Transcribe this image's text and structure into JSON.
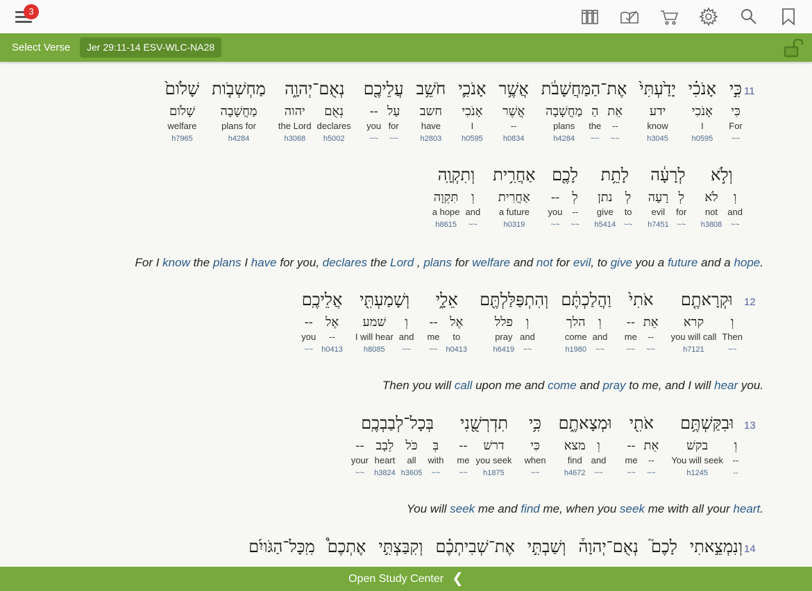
{
  "topbar": {
    "menu_badge": "3",
    "icons": [
      "library-icon",
      "reading-plan-icon",
      "cart-icon",
      "gear-icon",
      "search-icon",
      "bookmark-icon"
    ]
  },
  "toolbar": {
    "select_verse": "Select Verse",
    "reference": "Jer 29:11-14 ESV-WLC-NA28"
  },
  "verses": [
    {
      "num": "11",
      "lines": [
        [
          {
            "heb": "כִּ֣י",
            "morphs": [
              {
                "lex": "כִּי",
                "gloss": "For",
                "strong": "~~"
              }
            ]
          },
          {
            "heb": "אָנֹכִ֗י",
            "morphs": [
              {
                "lex": "אָנֹכִי",
                "gloss": "I",
                "strong": "h0595"
              }
            ]
          },
          {
            "heb": "יָדַ֙עְתִּי֙",
            "morphs": [
              {
                "lex": "ידע",
                "gloss": "know",
                "strong": "h3045"
              }
            ]
          },
          {
            "heb": "אֶת־הַמַּחֲשָׁבֹ֔ת",
            "morphs": [
              {
                "lex": "אֵת",
                "gloss": "--",
                "strong": "~~"
              },
              {
                "lex": "הַ",
                "gloss": "the",
                "strong": "~~"
              },
              {
                "lex": "מַחֲשָׁבָה",
                "gloss": "plans",
                "strong": "h4284"
              }
            ]
          },
          {
            "heb": "אֲשֶׁ֥ר",
            "morphs": [
              {
                "lex": "אֲשֶׁר",
                "gloss": "--",
                "strong": "h0834"
              }
            ]
          },
          {
            "heb": "אָנֹכִ֛י",
            "morphs": [
              {
                "lex": "אָנֹכִי",
                "gloss": "I",
                "strong": "h0595"
              }
            ]
          },
          {
            "heb": "חֹשֵׁ֥ב",
            "morphs": [
              {
                "lex": "חשב",
                "gloss": "have",
                "strong": "h2803"
              }
            ]
          },
          {
            "heb": "עֲלֵיכֶ֖ם",
            "morphs": [
              {
                "lex": "עַל",
                "gloss": "for",
                "strong": "~~"
              },
              {
                "lex": "--",
                "gloss": "you",
                "strong": "~~"
              }
            ]
          },
          {
            "heb": "נְאֻם־יְהוָ֑ה",
            "morphs": [
              {
                "lex": "נְאֻם",
                "gloss": "declares",
                "strong": "h5002"
              },
              {
                "lex": "יהוה",
                "gloss": "the Lord",
                "strong": "h3068"
              }
            ]
          },
          {
            "heb": "מַחְשְׁבֹ֤ות",
            "morphs": [
              {
                "lex": "מַחֲשָׁבָה",
                "gloss": "plans for",
                "strong": "h4284"
              }
            ]
          },
          {
            "heb": "שָׁלֹום֙",
            "morphs": [
              {
                "lex": "שָׁלֹום",
                "gloss": "welfare",
                "strong": "h7965"
              }
            ]
          }
        ],
        [
          {
            "heb": "וְלֹ֣א",
            "morphs": [
              {
                "lex": "וְ",
                "gloss": "and",
                "strong": "~~"
              },
              {
                "lex": "לֹא",
                "gloss": "not",
                "strong": "h3808"
              }
            ]
          },
          {
            "heb": "לְרָעָ֔ה",
            "morphs": [
              {
                "lex": "לְ",
                "gloss": "for",
                "strong": "~~"
              },
              {
                "lex": "רָעָה",
                "gloss": "evil",
                "strong": "h7451"
              }
            ]
          },
          {
            "heb": "לָתֵ֥ת",
            "morphs": [
              {
                "lex": "לְ",
                "gloss": "to",
                "strong": "~~"
              },
              {
                "lex": "נתן",
                "gloss": "give",
                "strong": "h5414"
              }
            ]
          },
          {
            "heb": "לָכֶ֖ם",
            "morphs": [
              {
                "lex": "לְ",
                "gloss": "--",
                "strong": "~~"
              },
              {
                "lex": "--",
                "gloss": "you",
                "strong": "~~"
              }
            ]
          },
          {
            "heb": "אַחֲרִ֥ית",
            "morphs": [
              {
                "lex": "אַחֲרִית",
                "gloss": "a future",
                "strong": "h0319"
              }
            ]
          },
          {
            "heb": "וְתִקְוָֽה",
            "morphs": [
              {
                "lex": "וְ",
                "gloss": "and",
                "strong": "~~"
              },
              {
                "lex": "תִּקְוָה",
                "gloss": "a hope",
                "strong": "h8615"
              }
            ]
          }
        ]
      ],
      "translation": [
        {
          "t": "For I "
        },
        {
          "t": "know",
          "h": true
        },
        {
          "t": " the "
        },
        {
          "t": "plans",
          "h": true
        },
        {
          "t": " I "
        },
        {
          "t": "have",
          "h": true
        },
        {
          "t": " for you, "
        },
        {
          "t": "declares",
          "h": true
        },
        {
          "t": " the "
        },
        {
          "t": "Lord",
          "h": true
        },
        {
          "t": " , "
        },
        {
          "t": "plans",
          "h": true
        },
        {
          "t": " for "
        },
        {
          "t": "welfare",
          "h": true
        },
        {
          "t": " and "
        },
        {
          "t": "not",
          "h": true
        },
        {
          "t": " for "
        },
        {
          "t": "evil",
          "h": true
        },
        {
          "t": ", to "
        },
        {
          "t": "give",
          "h": true
        },
        {
          "t": " you a "
        },
        {
          "t": "future",
          "h": true
        },
        {
          "t": " and a "
        },
        {
          "t": "hope",
          "h": true
        },
        {
          "t": "."
        }
      ]
    },
    {
      "num": "12",
      "lines": [
        [
          {
            "heb": "וּקְרָאתֶ֤ם",
            "morphs": [
              {
                "lex": "וְ",
                "gloss": "Then",
                "strong": "~~"
              },
              {
                "lex": "קרא",
                "gloss": "you will call",
                "strong": "h7121"
              }
            ]
          },
          {
            "heb": "אֹתִי֙",
            "morphs": [
              {
                "lex": "אֵת",
                "gloss": "--",
                "strong": "~~"
              },
              {
                "lex": "--",
                "gloss": "me",
                "strong": "~~"
              }
            ]
          },
          {
            "heb": "וַהֲלַכְתֶּ֔ם",
            "morphs": [
              {
                "lex": "וְ",
                "gloss": "and",
                "strong": "~~"
              },
              {
                "lex": "הלך",
                "gloss": "come",
                "strong": "h1980"
              }
            ]
          },
          {
            "heb": "וְהִתְפַּלַּלְתֶּ֖ם",
            "morphs": [
              {
                "lex": "וְ",
                "gloss": "and",
                "strong": "~~"
              },
              {
                "lex": "פלל",
                "gloss": "pray",
                "strong": "h6419"
              }
            ]
          },
          {
            "heb": "אֵלָ֑י",
            "morphs": [
              {
                "lex": "אֶל",
                "gloss": "to",
                "strong": "h0413"
              },
              {
                "lex": "--",
                "gloss": "me",
                "strong": "~~"
              }
            ]
          },
          {
            "heb": "וְשָׁמַעְתִּ֖י",
            "morphs": [
              {
                "lex": "וְ",
                "gloss": "and",
                "strong": "~~"
              },
              {
                "lex": "שׁמע",
                "gloss": "I will hear",
                "strong": "h8085"
              }
            ]
          },
          {
            "heb": "אֲלֵיכֶֽם",
            "morphs": [
              {
                "lex": "אֶל",
                "gloss": "--",
                "strong": "h0413"
              },
              {
                "lex": "--",
                "gloss": "you",
                "strong": "~~"
              }
            ]
          }
        ]
      ],
      "translation": [
        {
          "t": "Then you will "
        },
        {
          "t": "call",
          "h": true
        },
        {
          "t": " upon me and "
        },
        {
          "t": "come",
          "h": true
        },
        {
          "t": " and "
        },
        {
          "t": "pray",
          "h": true
        },
        {
          "t": " to me, and I will "
        },
        {
          "t": "hear",
          "h": true
        },
        {
          "t": " you."
        }
      ]
    },
    {
      "num": "13",
      "lines": [
        [
          {
            "heb": "וּבִקַּשְׁתֶּ֥ם",
            "morphs": [
              {
                "lex": "וְ",
                "gloss": "--",
                "strong": "--"
              },
              {
                "lex": "בקשׁ",
                "gloss": "You will seek",
                "strong": "h1245"
              }
            ]
          },
          {
            "heb": "אֹתִ֖י",
            "morphs": [
              {
                "lex": "אֵת",
                "gloss": "--",
                "strong": "~~"
              },
              {
                "lex": "--",
                "gloss": "me",
                "strong": "~~"
              }
            ]
          },
          {
            "heb": "וּמְצָאתֶ֑ם",
            "morphs": [
              {
                "lex": "וְ",
                "gloss": "and",
                "strong": "~~"
              },
              {
                "lex": "מצא",
                "gloss": "find",
                "strong": "h4672"
              }
            ]
          },
          {
            "heb": "כִּ֥י",
            "morphs": [
              {
                "lex": "כִּי",
                "gloss": "when",
                "strong": "~~"
              }
            ]
          },
          {
            "heb": "תִדְרְשֻׁ֖נִי",
            "morphs": [
              {
                "lex": "דרשׁ",
                "gloss": "you seek",
                "strong": "h1875"
              },
              {
                "lex": "--",
                "gloss": "me",
                "strong": "~~"
              }
            ]
          },
          {
            "heb": "בְּכָל־לְבַבְכֶֽם",
            "morphs": [
              {
                "lex": "בְּ",
                "gloss": "with",
                "strong": "~~"
              },
              {
                "lex": "כֹּל",
                "gloss": "all",
                "strong": "h3605"
              },
              {
                "lex": "לֵבָב",
                "gloss": "heart",
                "strong": "h3824"
              },
              {
                "lex": "--",
                "gloss": "your",
                "strong": "~~"
              }
            ]
          }
        ]
      ],
      "translation": [
        {
          "t": "You will "
        },
        {
          "t": "seek",
          "h": true
        },
        {
          "t": " me and "
        },
        {
          "t": "find",
          "h": true
        },
        {
          "t": " me, when you "
        },
        {
          "t": "seek",
          "h": true
        },
        {
          "t": " me with all your "
        },
        {
          "t": "heart",
          "h": true
        },
        {
          "t": "."
        }
      ]
    },
    {
      "num": "14",
      "lines": [
        [
          {
            "heb": "וְנִמְצֵ֣אתִי",
            "morphs": []
          },
          {
            "heb": "לָכֶם֮",
            "morphs": []
          },
          {
            "heb": "נְאֻם־יְהוָה֒",
            "morphs": []
          },
          {
            "heb": "וְשַׁבְתִּ֣י",
            "morphs": []
          },
          {
            "heb": "אֶת־שְׁבִיתְכֶ֗ם",
            "morphs": []
          },
          {
            "heb": "וְקִבַּצְתִּ֣י",
            "morphs": []
          },
          {
            "heb": "אֶתְכֶם֩",
            "morphs": []
          },
          {
            "heb": "מִֽכָּל־הַגֹּויִ֜ם",
            "morphs": []
          }
        ]
      ],
      "translation": []
    }
  ],
  "bottom": {
    "label": "Open Study Center"
  }
}
